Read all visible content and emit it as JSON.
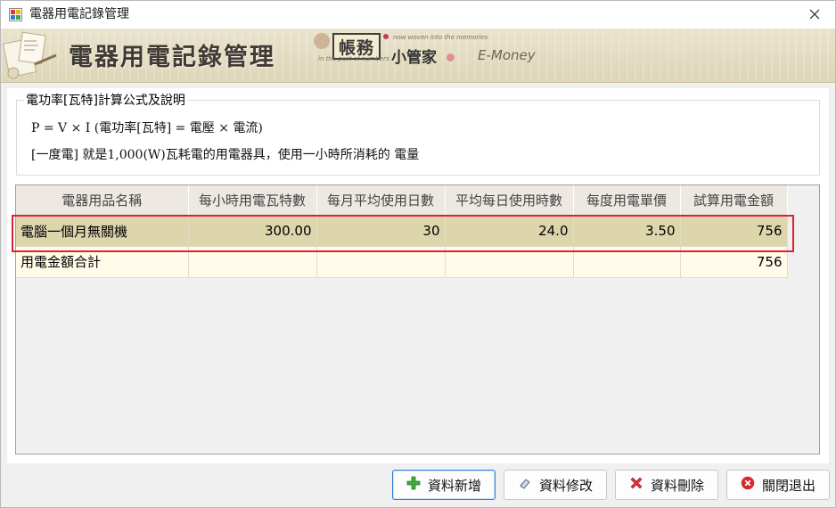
{
  "window": {
    "title": "電器用電記錄管理"
  },
  "banner": {
    "title": "電器用電記錄管理",
    "logo_main": "帳務",
    "logo_sub": "小管家",
    "logo_tagline_top": "now woven into the memories",
    "logo_tagline_bottom": "in the past of numbers",
    "logo_brand": "E-Money"
  },
  "formula": {
    "legend": "電功率[瓦特]計算公式及說明",
    "line1": "P = V × I (電功率[瓦特] = 電壓 × 電流)",
    "line2": "[一度電] 就是1,000(W)瓦耗電的用電器具，使用一小時所消耗的 電量"
  },
  "grid": {
    "columns": [
      "電器用品名稱",
      "每小時用電瓦特數",
      "每月平均使用日數",
      "平均每日使用時數",
      "每度用電單價",
      "試算用電金額"
    ],
    "rows": [
      [
        "電腦一個月無關機",
        "300.00",
        "30",
        "24.0",
        "3.50",
        "756"
      ]
    ],
    "total_row": [
      "用電金額合計",
      "",
      "",
      "",
      "",
      "756"
    ]
  },
  "buttons": {
    "add": "資料新增",
    "edit": "資料修改",
    "delete": "資料刪除",
    "exit": "關閉退出"
  },
  "icons": {
    "add": "plus-icon",
    "edit": "eraser-icon",
    "delete": "x-mark-icon",
    "exit": "close-circle-icon"
  },
  "colors": {
    "selected_row": "#ddd6ad",
    "selection_outline": "#e02030",
    "total_row": "#fffbe8",
    "banner": "#e4ddc2"
  }
}
